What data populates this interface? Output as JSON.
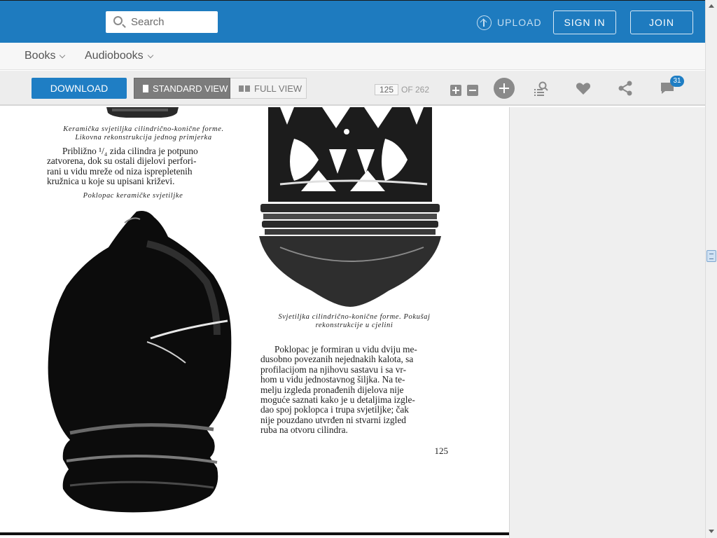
{
  "header": {
    "search_placeholder": "Search",
    "upload_label": "UPLOAD",
    "signin_label": "SIGN IN",
    "join_label": "JOIN"
  },
  "nav": {
    "books_label": "Books",
    "audiobooks_label": "Audiobooks"
  },
  "toolbar": {
    "download_label": "DOWNLOAD",
    "standard_view_label": "STANDARD VIEW",
    "full_view_label": "FULL VIEW",
    "current_page": "125",
    "of_pages": "OF 262",
    "comment_count": "31"
  },
  "document": {
    "caption_top_line1": "Keramička svjetiljka cilindrično-konične forme.",
    "caption_top_line2": "Likovna rekonstrukcija jednog primjerka",
    "para1_lines": [
      "Približno ¹/₄ zida cilindra je potpuno",
      "zatvorena, dok su ostali dijelovi perfori-",
      "rani u vidu mreže od niza isprepletenih",
      "kružnica u koje su upisani križevi."
    ],
    "caption_cover": "Poklopac keramičke svjetiljke",
    "caption_lamp_line1": "Svjetiljka cilindrično-konične forme. Pokušaj",
    "caption_lamp_line2": "rekonstrukcije u cjelini",
    "para2_lines": [
      "Poklopac je formiran u vidu dviju me-",
      "dusobno povezanih nejednakih kalota, sa",
      "profilacijom na njihovu sastavu i sa vr-",
      "hom u vidu jednostavnog šiljka. Na te-",
      "melju izgleda pronađenih dijelova nije",
      "moguće saznati kako je u detaljima izgle-",
      "dao spoj poklopca i trupa svjetiljke; čak",
      "nije pouzdano utvrđen ni stvarni  izgled",
      "ruba na otvoru cilindra."
    ],
    "page_number": "125"
  },
  "icons": {
    "search": "search-icon",
    "upload": "upload-icon",
    "zoom_in": "zoom-in-icon",
    "zoom_out": "zoom-out-icon",
    "add": "add-icon",
    "search_document": "search-document-icon",
    "like": "heart-icon",
    "share": "share-icon",
    "comments": "comment-icon"
  },
  "colors": {
    "brand_blue": "#1e7bbf",
    "download_blue": "#1f7ec4",
    "toolbar_gray": "#ededed"
  }
}
